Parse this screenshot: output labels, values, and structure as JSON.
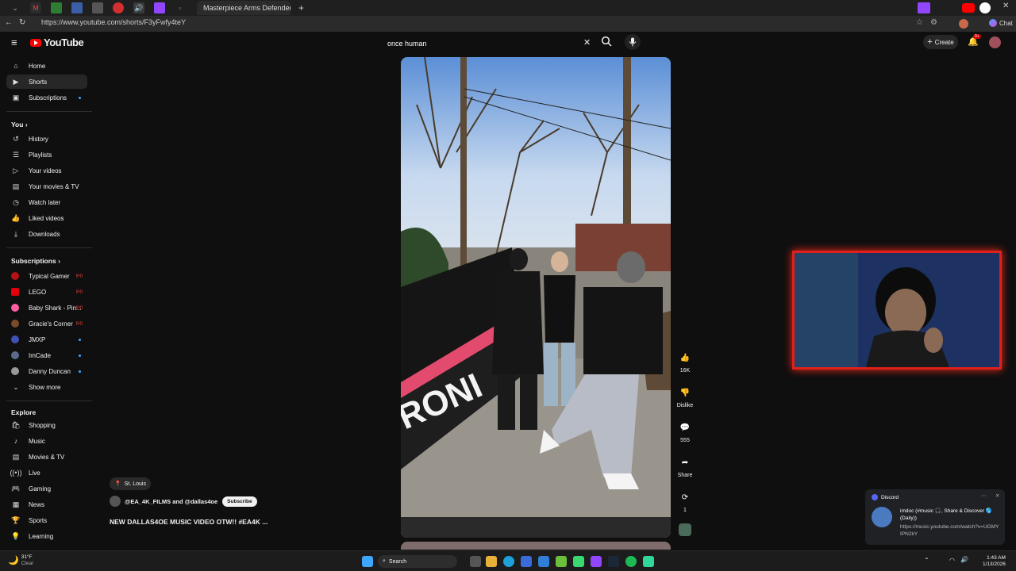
{
  "browser": {
    "active_tab_title": "Masterpiece Arms Defender Top G",
    "url": "https://www.youtube.com/shorts/F3yFwfy4teY",
    "chat_label": "Chat"
  },
  "header": {
    "logo": "YouTube",
    "search_value": "once human",
    "create_label": "Create",
    "notification_count": "9+"
  },
  "sidebar": {
    "main": [
      {
        "label": "Home",
        "icon": "home-icon"
      },
      {
        "label": "Shorts",
        "icon": "shorts-icon"
      },
      {
        "label": "Subscriptions",
        "icon": "subscriptions-icon"
      }
    ],
    "you_heading": "You",
    "you": [
      {
        "label": "History"
      },
      {
        "label": "Playlists"
      },
      {
        "label": "Your videos"
      },
      {
        "label": "Your movies & TV"
      },
      {
        "label": "Watch later"
      },
      {
        "label": "Liked videos"
      },
      {
        "label": "Downloads"
      }
    ],
    "subs_heading": "Subscriptions",
    "subs": [
      {
        "label": "Typical Gamer",
        "color": "#b31217"
      },
      {
        "label": "LEGO",
        "color": "#e3000b"
      },
      {
        "label": "Baby Shark - Pin...",
        "color": "#ff5fa2"
      },
      {
        "label": "Gracie's Corner",
        "color": "#7a4b2a"
      },
      {
        "label": "JMXP",
        "color": "#3f51b5"
      },
      {
        "label": "ImCade",
        "color": "#5a6b8c"
      },
      {
        "label": "Danny Duncan",
        "color": "#9a9a9a"
      }
    ],
    "show_more": "Show more",
    "explore_heading": "Explore",
    "explore": [
      {
        "label": "Shopping"
      },
      {
        "label": "Music"
      },
      {
        "label": "Movies & TV"
      },
      {
        "label": "Live"
      },
      {
        "label": "Gaming"
      },
      {
        "label": "News"
      },
      {
        "label": "Sports"
      },
      {
        "label": "Learning"
      }
    ]
  },
  "short": {
    "location": "St. Louis",
    "channel": "@EA_4K_FILMS and @dallas4oe",
    "subscribe_label": "Subscribe",
    "title": "NEW DALLAS4OE MUSIC VIDEO OTW!! #EA4K ...",
    "likes": "16K",
    "dislike_label": "Dislike",
    "comments": "555",
    "share_label": "Share",
    "remix_count": "1"
  },
  "discord_toast": {
    "app": "Discord",
    "line1": "imdoc (#music 🎧, Share & Discover 🌎 (Daily))",
    "line2": "https://music.youtube.com/watch?v=UGMYIPN2kY"
  },
  "taskbar": {
    "weather_temp": "31°F",
    "weather_desc": "Clear",
    "search_label": "Search",
    "time": "1:43 AM",
    "date": "1/13/2026"
  }
}
